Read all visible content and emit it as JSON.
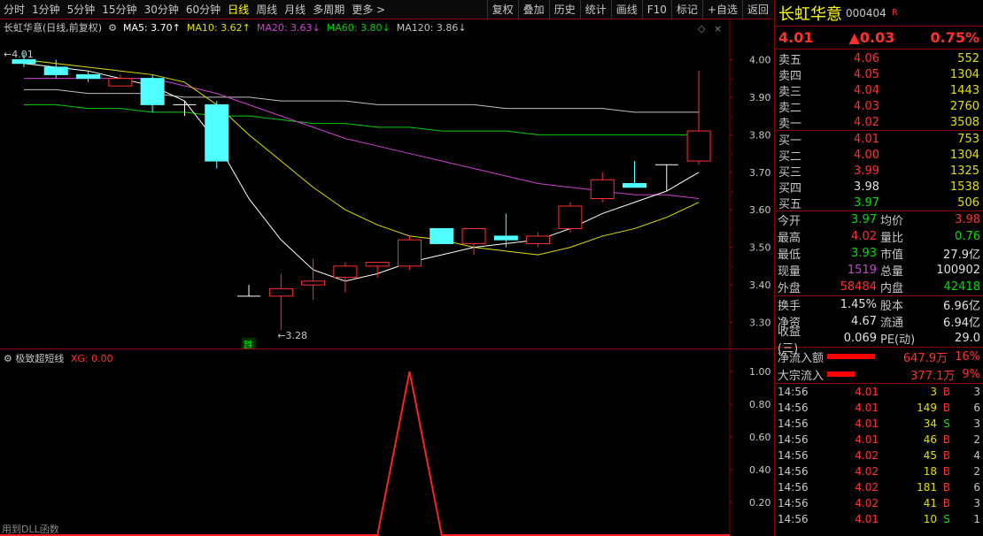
{
  "toolbar": {
    "left": [
      "分时",
      "1分钟",
      "5分钟",
      "15分钟",
      "30分钟",
      "60分钟",
      "日线",
      "周线",
      "月线",
      "多周期",
      "更多 >"
    ],
    "active": "日线",
    "right": [
      "复权",
      "叠加",
      "历史",
      "统计",
      "画线",
      "F10",
      "标记",
      "+自选",
      "返回"
    ]
  },
  "title_bar": {
    "stock": "长虹华意(日线,前复权)",
    "ma5": "MA5: 3.70↑",
    "ma10": "MA10: 3.62↑",
    "ma20": "MA20: 3.63↓",
    "ma60": "MA60: 3.80↓",
    "ma120": "MA120: 3.86↓"
  },
  "main_annotations": {
    "high_label": "4.01",
    "low_label": "3.28",
    "event_badge": "跌"
  },
  "colors": {
    "up": "#ff3030",
    "down": "#50ffff",
    "ma5": "#ffffff",
    "ma10": "#e0e000",
    "ma20": "#d040d0",
    "ma60": "#00d000",
    "ma120": "#c0c0c0",
    "border": "#8b0000"
  },
  "chart_data": [
    {
      "type": "candlestick",
      "title": "长虹华意(日线,前复权)",
      "yticks": [
        "4.00",
        "3.90",
        "3.80",
        "3.70",
        "3.60",
        "3.50",
        "3.40",
        "3.30"
      ],
      "ylim": [
        3.24,
        4.06
      ],
      "candles": [
        {
          "o": 4.0,
          "h": 4.02,
          "l": 3.98,
          "c": 3.99
        },
        {
          "o": 3.98,
          "h": 4.0,
          "l": 3.95,
          "c": 3.96
        },
        {
          "o": 3.96,
          "h": 3.97,
          "l": 3.94,
          "c": 3.95
        },
        {
          "o": 3.93,
          "h": 3.96,
          "l": 3.93,
          "c": 3.95
        },
        {
          "o": 3.95,
          "h": 3.96,
          "l": 3.86,
          "c": 3.88
        },
        {
          "o": 3.88,
          "h": 3.89,
          "l": 3.85,
          "c": 3.88
        },
        {
          "o": 3.88,
          "h": 3.89,
          "l": 3.71,
          "c": 3.73
        },
        {
          "o": 3.37,
          "h": 3.4,
          "l": 3.37,
          "c": 3.37
        },
        {
          "o": 3.37,
          "h": 3.43,
          "l": 3.28,
          "c": 3.39
        },
        {
          "o": 3.4,
          "h": 3.47,
          "l": 3.36,
          "c": 3.41
        },
        {
          "o": 3.42,
          "h": 3.46,
          "l": 3.38,
          "c": 3.45
        },
        {
          "o": 3.45,
          "h": 3.46,
          "l": 3.42,
          "c": 3.46
        },
        {
          "o": 3.45,
          "h": 3.53,
          "l": 3.44,
          "c": 3.52
        },
        {
          "o": 3.55,
          "h": 3.55,
          "l": 3.51,
          "c": 3.51
        },
        {
          "o": 3.51,
          "h": 3.55,
          "l": 3.48,
          "c": 3.55
        },
        {
          "o": 3.53,
          "h": 3.59,
          "l": 3.5,
          "c": 3.52
        },
        {
          "o": 3.51,
          "h": 3.54,
          "l": 3.5,
          "c": 3.53
        },
        {
          "o": 3.55,
          "h": 3.62,
          "l": 3.54,
          "c": 3.61
        },
        {
          "o": 3.63,
          "h": 3.7,
          "l": 3.62,
          "c": 3.68
        },
        {
          "o": 3.67,
          "h": 3.73,
          "l": 3.66,
          "c": 3.66
        },
        {
          "o": 3.72,
          "h": 3.72,
          "l": 3.65,
          "c": 3.72
        },
        {
          "o": 3.73,
          "h": 3.97,
          "l": 3.72,
          "c": 3.81
        }
      ],
      "ma5": [
        3.99,
        3.98,
        3.97,
        3.95,
        3.93,
        3.89,
        3.78,
        3.63,
        3.52,
        3.44,
        3.41,
        3.43,
        3.46,
        3.48,
        3.5,
        3.51,
        3.52,
        3.55,
        3.59,
        3.62,
        3.65,
        3.7
      ],
      "ma10": [
        4.0,
        3.99,
        3.98,
        3.97,
        3.96,
        3.94,
        3.88,
        3.8,
        3.73,
        3.66,
        3.6,
        3.56,
        3.53,
        3.52,
        3.5,
        3.49,
        3.48,
        3.5,
        3.53,
        3.55,
        3.58,
        3.62
      ],
      "ma20": [
        3.95,
        3.95,
        3.95,
        3.95,
        3.95,
        3.93,
        3.91,
        3.88,
        3.85,
        3.82,
        3.79,
        3.77,
        3.75,
        3.73,
        3.71,
        3.69,
        3.67,
        3.66,
        3.65,
        3.64,
        3.64,
        3.63
      ],
      "ma60": [
        3.88,
        3.88,
        3.87,
        3.87,
        3.86,
        3.86,
        3.85,
        3.85,
        3.84,
        3.83,
        3.83,
        3.82,
        3.82,
        3.81,
        3.81,
        3.81,
        3.8,
        3.8,
        3.8,
        3.8,
        3.8,
        3.8
      ],
      "ma120": [
        3.92,
        3.92,
        3.91,
        3.91,
        3.91,
        3.9,
        3.9,
        3.9,
        3.89,
        3.89,
        3.89,
        3.88,
        3.88,
        3.88,
        3.88,
        3.87,
        3.87,
        3.87,
        3.87,
        3.86,
        3.86,
        3.86
      ]
    },
    {
      "type": "line",
      "title": "极致超短线",
      "series_label": "XG: 0.00",
      "yticks": [
        "1.00",
        "0.80",
        "0.60",
        "0.40",
        "0.20"
      ],
      "ylim": [
        0,
        1.06
      ],
      "values": [
        0,
        0,
        0,
        0,
        0,
        0,
        0,
        0,
        0,
        0,
        0,
        0,
        1,
        0,
        0,
        0,
        0,
        0,
        0,
        0,
        0,
        0
      ],
      "footnote": "用到DLL函数"
    }
  ],
  "panel": {
    "name": "长虹华意",
    "code": "000404",
    "flag": "R",
    "price": "4.01",
    "change": "▲0.03",
    "pct": "0.75%",
    "asks": [
      {
        "label": "卖五",
        "price": "4.06",
        "vol": "552"
      },
      {
        "label": "卖四",
        "price": "4.05",
        "vol": "1304"
      },
      {
        "label": "卖三",
        "price": "4.04",
        "vol": "1443"
      },
      {
        "label": "卖二",
        "price": "4.03",
        "vol": "2760"
      },
      {
        "label": "卖一",
        "price": "4.02",
        "vol": "3508"
      }
    ],
    "bids": [
      {
        "label": "买一",
        "price": "4.01",
        "vol": "753",
        "color": "red"
      },
      {
        "label": "买二",
        "price": "4.00",
        "vol": "1304",
        "color": "red"
      },
      {
        "label": "买三",
        "price": "3.99",
        "vol": "1325",
        "color": "red"
      },
      {
        "label": "买四",
        "price": "3.98",
        "vol": "1538",
        "color": "white"
      },
      {
        "label": "买五",
        "price": "3.97",
        "vol": "506",
        "color": "green"
      }
    ],
    "stats1": [
      {
        "k": "今开",
        "v": "3.97",
        "vc": "green",
        "k2": "均价",
        "v2": "3.98",
        "v2c": "red"
      },
      {
        "k": "最高",
        "v": "4.02",
        "vc": "red",
        "k2": "量比",
        "v2": "0.76",
        "v2c": "green"
      },
      {
        "k": "最低",
        "v": "3.93",
        "vc": "green",
        "k2": "市值",
        "v2": "27.9亿",
        "v2c": "white"
      },
      {
        "k": "现量",
        "v": "1519",
        "vc": "purple",
        "k2": "总量",
        "v2": "100902",
        "v2c": "white"
      },
      {
        "k": "外盘",
        "v": "58484",
        "vc": "red",
        "k2": "内盘",
        "v2": "42418",
        "v2c": "green"
      }
    ],
    "stats2": [
      {
        "k": "换手",
        "v": "1.45%",
        "k2": "股本",
        "v2": "6.96亿"
      },
      {
        "k": "净资",
        "v": "4.67",
        "k2": "流通",
        "v2": "6.94亿"
      },
      {
        "k": "收益(三)",
        "v": "0.069",
        "k2": "PE(动)",
        "v2": "29.0"
      }
    ],
    "flows": [
      {
        "label": "净流入额",
        "amount": "647.9万",
        "pct": "16%",
        "fill": 0.16
      },
      {
        "label": "大宗流入",
        "amount": "377.1万",
        "pct": "9%",
        "fill": 0.09
      }
    ],
    "trades": [
      {
        "time": "14:56",
        "price": "4.01",
        "vol": "3",
        "bs": "B",
        "n": "3"
      },
      {
        "time": "14:56",
        "price": "4.01",
        "vol": "149",
        "bs": "B",
        "n": "6"
      },
      {
        "time": "14:56",
        "price": "4.01",
        "vol": "34",
        "bs": "S",
        "n": "3"
      },
      {
        "time": "14:56",
        "price": "4.01",
        "vol": "46",
        "bs": "B",
        "n": "2"
      },
      {
        "time": "14:56",
        "price": "4.02",
        "vol": "45",
        "bs": "B",
        "n": "4"
      },
      {
        "time": "14:56",
        "price": "4.02",
        "vol": "18",
        "bs": "B",
        "n": "2"
      },
      {
        "time": "14:56",
        "price": "4.02",
        "vol": "181",
        "bs": "B",
        "n": "6"
      },
      {
        "time": "14:56",
        "price": "4.02",
        "vol": "41",
        "bs": "B",
        "n": "3"
      },
      {
        "time": "14:56",
        "price": "4.01",
        "vol": "10",
        "bs": "S",
        "n": "1"
      }
    ]
  }
}
